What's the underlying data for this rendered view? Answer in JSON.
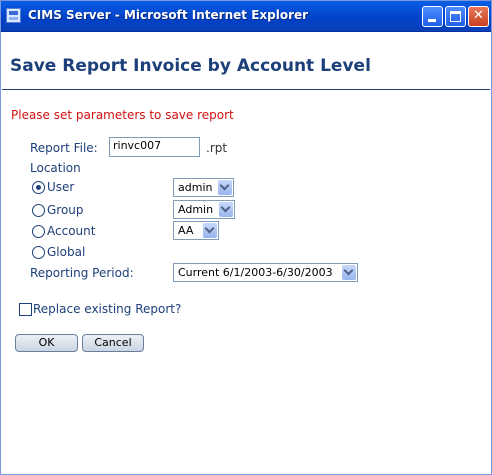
{
  "window": {
    "title": "CIMS Server - Microsoft Internet Explorer"
  },
  "page": {
    "heading": "Save Report Invoice by Account Level",
    "message": "Please set parameters to save report"
  },
  "form": {
    "report_file_label": "Report File:",
    "report_file_value": "rinvc007",
    "report_file_ext": ".rpt",
    "location_label": "Location",
    "location_options": [
      {
        "label": "User",
        "checked": true,
        "select_value": "admin"
      },
      {
        "label": "Group",
        "checked": false,
        "select_value": "Admin"
      },
      {
        "label": "Account",
        "checked": false,
        "select_value": "AA"
      },
      {
        "label": "Global",
        "checked": false
      }
    ],
    "reporting_period_label": "Reporting Period:",
    "reporting_period_value": "Current 6/1/2003-6/30/2003",
    "replace_label": "Replace existing Report?",
    "replace_checked": false,
    "ok_label": "OK",
    "cancel_label": "Cancel"
  },
  "colors": {
    "heading": "#1d3f7a",
    "message": "#d01010",
    "titlebar": "#0042c9"
  }
}
